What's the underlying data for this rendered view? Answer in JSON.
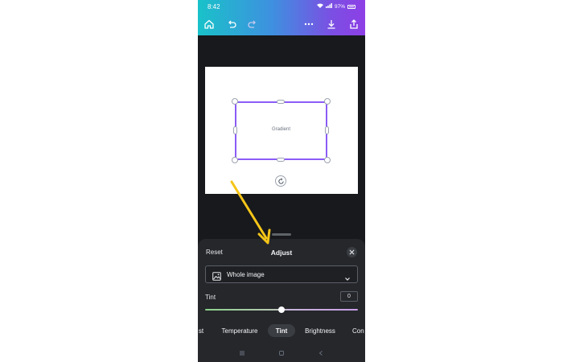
{
  "status_bar": {
    "time": "8:42",
    "battery": "97%"
  },
  "toolbar": {
    "icons": [
      "home-icon",
      "undo-icon",
      "redo-icon",
      "more-icon",
      "download-icon",
      "share-icon"
    ]
  },
  "canvas": {
    "element_label": "Gradient"
  },
  "panel": {
    "reset_label": "Reset",
    "title": "Adjust",
    "scope_dropdown": {
      "selected": "Whole image"
    },
    "slider": {
      "label": "Tint",
      "value": "0",
      "value_fraction": 0.5
    },
    "tabs": [
      {
        "label": "st",
        "active": false
      },
      {
        "label": "Temperature",
        "active": false
      },
      {
        "label": "Tint",
        "active": true
      },
      {
        "label": "Brightness",
        "active": false
      },
      {
        "label": "Con",
        "active": false
      }
    ]
  },
  "colors": {
    "accent_gradient_start": "#19c2c9",
    "accent_gradient_end": "#8d3fe6",
    "selection": "#8b5cf6",
    "annotation_arrow": "#f5c518",
    "panel_background": "#25272b"
  }
}
